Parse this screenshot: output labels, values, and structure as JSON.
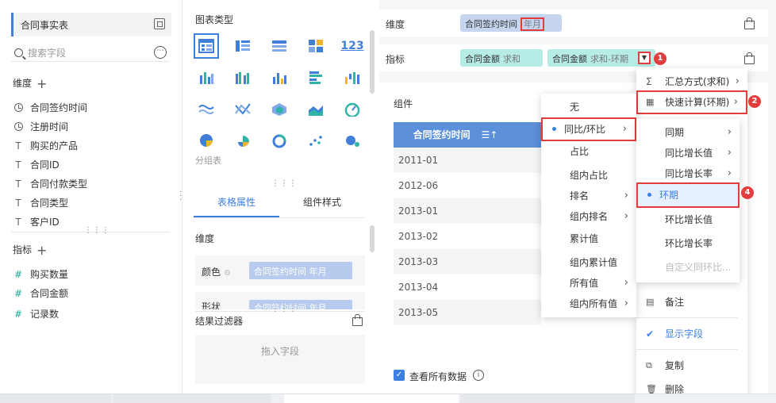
{
  "left": {
    "dataset_name": "合同事实表",
    "search_placeholder": "搜索字段",
    "more_icon": "⋯",
    "dimension_title": "维度",
    "dimension_fields": [
      "合同签约时间",
      "注册时间",
      "购买的产品",
      "合同ID",
      "合同付款类型",
      "合同类型",
      "客户ID"
    ],
    "measure_title": "指标",
    "measure_fields": [
      "购买数量",
      "合同金额",
      "记录数"
    ]
  },
  "mid": {
    "chart_type_title": "图表类型",
    "group_label": "分组表",
    "tabs": [
      "表格属性",
      "组件样式"
    ],
    "dimension_title": "维度",
    "color_label": "颜色",
    "color_pill_text": "合同签约时间 年月",
    "shape_label": "形状",
    "filter_title": "结果过滤器",
    "drop_text": "拖入字段"
  },
  "shelf": {
    "dimension_label": "维度",
    "dimension_pill": "合同签约时间",
    "dimension_pill_sub": "年月",
    "measure_label": "指标",
    "measure_pill_1": "合同金额",
    "measure_pill_1_sub": "求和",
    "measure_pill_2": "合同金额",
    "measure_pill_2_sub": "求和-环期"
  },
  "canvas": {
    "title": "组件",
    "header": "合同签约时间",
    "rows": [
      "2011-01",
      "2012-06",
      "2013-01",
      "2013-02",
      "2013-03",
      "2013-04",
      "2013-05"
    ],
    "show_all_label": "查看所有数据"
  },
  "menu_main": {
    "items": [
      "汇总方式(求和)",
      "快速计算(环期)",
      "备注",
      "显示字段",
      "复制",
      "删除"
    ]
  },
  "menu_quick": {
    "items": [
      "无",
      "同比/环比",
      "占比",
      "组内占比",
      "排名",
      "组内排名",
      "累计值",
      "组内累计值",
      "所有值",
      "组内所有值"
    ]
  },
  "menu_yoy": {
    "items": [
      "同期",
      "同比增长值",
      "同比增长率",
      "环期",
      "环比增长值",
      "环比增长率",
      "自定义同环比..."
    ]
  },
  "badges": [
    "1",
    "2",
    "3",
    "4"
  ],
  "bottom_tabs": [
    "",
    "",
    "",
    ""
  ]
}
